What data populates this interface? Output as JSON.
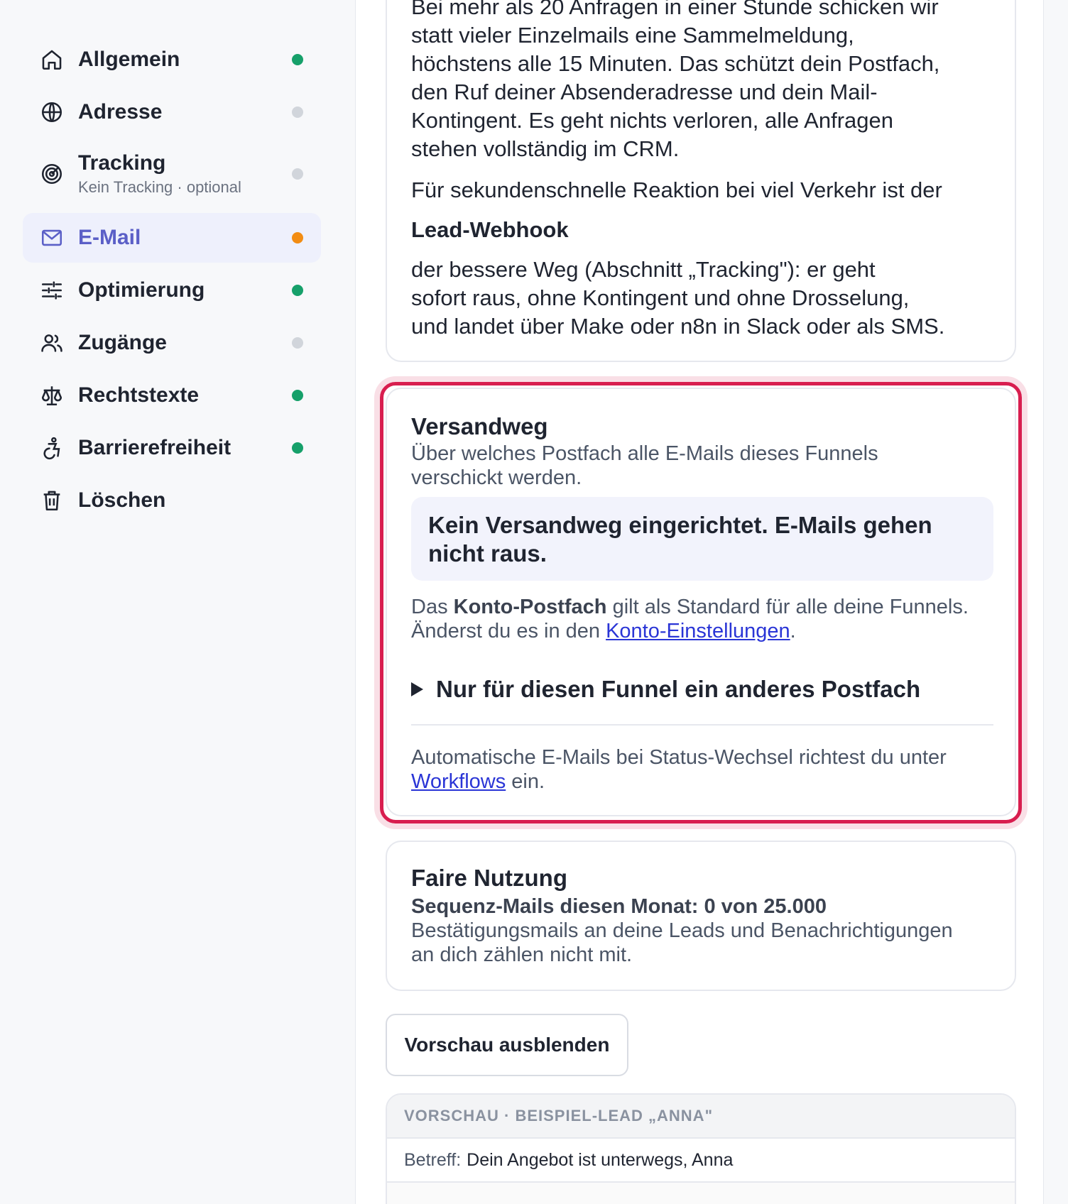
{
  "sidebar": {
    "items": [
      {
        "label": "Allgemein",
        "sub": "",
        "icon": "home-icon",
        "status": "#16a06a"
      },
      {
        "label": "Adresse",
        "sub": "",
        "icon": "globe-icon",
        "status": "#d1d5db"
      },
      {
        "label": "Tracking",
        "sub": "Kein Tracking · optional",
        "icon": "radar-icon",
        "status": "#d1d5db"
      },
      {
        "label": "E-Mail",
        "sub": "",
        "icon": "mail-icon",
        "status": "#f28c13"
      },
      {
        "label": "Optimierung",
        "sub": "",
        "icon": "sliders-icon",
        "status": "#16a06a"
      },
      {
        "label": "Zugänge",
        "sub": "",
        "icon": "users-icon",
        "status": "#d1d5db"
      },
      {
        "label": "Rechtstexte",
        "sub": "",
        "icon": "scale-icon",
        "status": "#16a06a"
      },
      {
        "label": "Barrierefreiheit",
        "sub": "",
        "icon": "accessibility-icon",
        "status": "#16a06a"
      },
      {
        "label": "Löschen",
        "sub": "",
        "icon": "trash-icon",
        "status": ""
      }
    ]
  },
  "intro": {
    "para1_lines": [
      "Bei mehr als 20 Anfragen in einer Stunde schicken wir",
      "statt vieler Einzelmails eine Sammelmeldung,",
      "höchstens alle 15 Minuten. Das schützt dein Postfach,",
      "den Ruf deiner Absenderadresse und dein Mail-",
      "Kontingent. Es geht nichts verloren, alle Anfragen",
      "stehen vollständig im CRM."
    ],
    "para2": "Für sekundenschnelle Reaktion bei viel Verkehr ist der",
    "webhook_title": "Lead-Webhook",
    "para3_lines": [
      "der bessere Weg (Abschnitt „Tracking\"): er geht",
      "sofort raus, ohne Kontingent und ohne Drosselung,",
      "und landet über Make oder n8n in Slack oder als SMS."
    ]
  },
  "versandweg": {
    "title": "Versandweg",
    "subtitle_lines": [
      "Über welches Postfach alle E-Mails dieses Funnels",
      "verschickt werden."
    ],
    "notice_lines": [
      "Kein Versandweg eingerichtet. E-Mails gehen",
      "nicht raus."
    ],
    "info_prefix": "Das ",
    "info_bold": "Konto-Postfach",
    "info_rest": " gilt als Standard für alle deine Funnels.",
    "info_line2_prefix": "Änderst du es in den ",
    "info_link": "Konto-Einstellungen",
    "info_line2_suffix": ".",
    "details_label": "Nur für diesen Funnel ein anderes Postfach",
    "footer_line1": "Automatische E-Mails bei Status-Wechsel richtest du unter",
    "footer_link": "Workflows",
    "footer_suffix": " ein.",
    "accent_color": "#d81e4f"
  },
  "faire": {
    "title": "Faire Nutzung",
    "usage": "Sequenz-Mails diesen Monat: 0 von 25.000",
    "note_lines": [
      "Bestätigungsmails an deine Leads und Benachrichtigungen",
      "an dich zählen nicht mit."
    ]
  },
  "preview_button": "Vorschau ausblenden",
  "preview": {
    "header": "VORSCHAU · BEISPIEL-LEAD „ANNA\"",
    "subject_key": "Betreff:",
    "subject_value": "Dein Angebot ist unterwegs, Anna"
  }
}
